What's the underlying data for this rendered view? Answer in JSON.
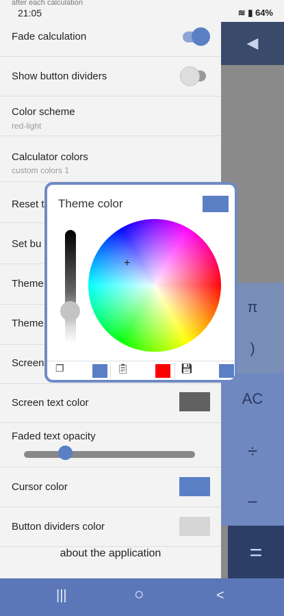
{
  "status": {
    "partial_text": "after each calculation",
    "time": "21:05",
    "battery": "64%"
  },
  "settings": {
    "fade_calculation": "Fade calculation",
    "show_button_dividers": "Show button dividers",
    "color_scheme": {
      "title": "Color scheme",
      "value": "red-light"
    },
    "calculator_colors": {
      "title": "Calculator colors",
      "value": "custom colors 1"
    },
    "reset": "Reset t",
    "set_buttons": "Set bu",
    "theme1": "Theme",
    "theme2": "Theme",
    "screen": "Screen",
    "screen_text_color": "Screen text color",
    "faded_text_opacity": "Faded text opacity",
    "faded_text_opacity_value": 0.24,
    "cursor_color": "Cursor color",
    "button_dividers_color": "Button dividers color",
    "about": "about the application"
  },
  "dialog": {
    "title": "Theme color"
  },
  "calc": {
    "back": "◀",
    "pi": "π",
    "paren": ")",
    "ac": "AC",
    "divide": "÷",
    "minus": "−",
    "equals": "="
  },
  "nav": {
    "recent": "|||",
    "home": "○",
    "back": "<"
  },
  "colors": {
    "accent": "#5a7fc4",
    "screen_text": "#616161",
    "divider": "#d6d6d6",
    "dialog_red": "#ff0000"
  }
}
